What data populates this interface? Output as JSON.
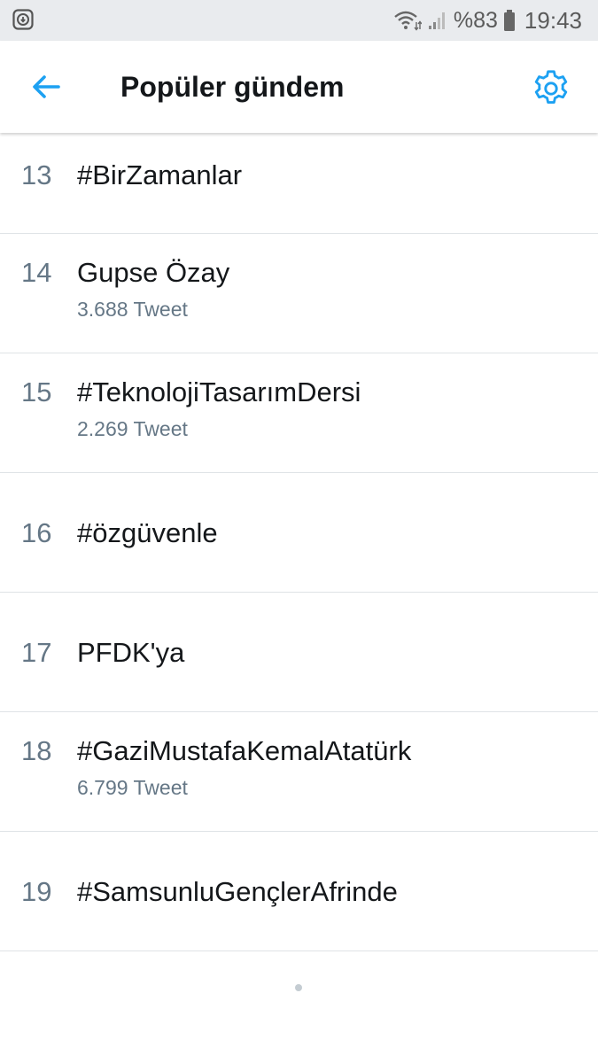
{
  "status_bar": {
    "battery_percent": "%83",
    "time": "19:43",
    "icons": [
      "download-icon",
      "wifi-icon",
      "signal-icon",
      "battery-icon"
    ]
  },
  "header": {
    "title": "Popüler gündem",
    "back_icon": "back-arrow-icon",
    "settings_icon": "gear-icon"
  },
  "colors": {
    "accent": "#1da1f2",
    "text_primary": "#14171a",
    "text_secondary": "#657786",
    "divider": "#dfe3e6",
    "status_bar_bg": "#e9ebee"
  },
  "trends": [
    {
      "rank": "13",
      "name": "#BirZamanlar",
      "count": ""
    },
    {
      "rank": "14",
      "name": "Gupse Özay",
      "count": "3.688 Tweet"
    },
    {
      "rank": "15",
      "name": "#TeknolojiTasarımDersi",
      "count": "2.269 Tweet"
    },
    {
      "rank": "16",
      "name": "#özgüvenle",
      "count": ""
    },
    {
      "rank": "17",
      "name": "PFDK'ya",
      "count": ""
    },
    {
      "rank": "18",
      "name": "#GaziMustafaKemalAtatürk",
      "count": "6.799 Tweet"
    },
    {
      "rank": "19",
      "name": "#SamsunluGençlerAfrinde",
      "count": ""
    }
  ]
}
